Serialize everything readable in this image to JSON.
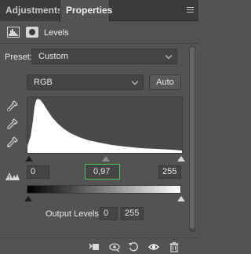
{
  "tabs": [
    {
      "label": "Adjustments",
      "active": false
    },
    {
      "label": "Properties",
      "active": true
    }
  ],
  "header": {
    "title": "Levels",
    "adjustment_icon": "levels-histogram-icon",
    "mask_icon": "layer-mask-icon"
  },
  "preset": {
    "label": "Preset:",
    "value": "Custom"
  },
  "channel": {
    "value": "RGB",
    "auto_label": "Auto"
  },
  "eyedroppers": [
    "black-point-eyedropper-icon",
    "gray-point-eyedropper-icon",
    "white-point-eyedropper-icon"
  ],
  "input_levels": {
    "black": "0",
    "gamma": "0,97",
    "white": "255"
  },
  "output_levels": {
    "label": "Output Levels:",
    "black": "0",
    "white": "255"
  },
  "footer_icons": [
    "clip-to-layer-icon",
    "view-previous-state-icon",
    "reset-icon",
    "visibility-eye-icon",
    "trash-icon"
  ],
  "colors": {
    "panel_bg": "#535353",
    "tabbar_bg": "#3c3c3c",
    "gamma_focus": "#4cc25a"
  }
}
